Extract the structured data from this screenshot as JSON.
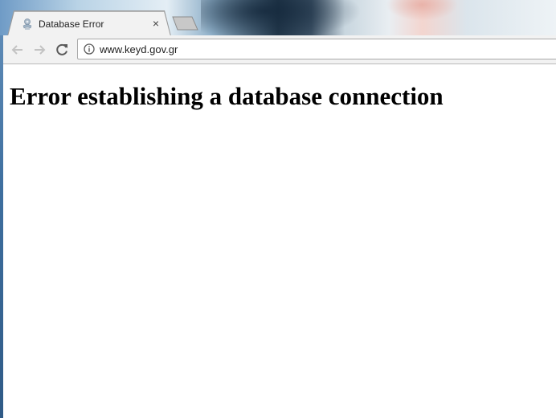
{
  "tab": {
    "title": "Database Error",
    "favicon": "wordpress-seal-icon",
    "close_label": "×"
  },
  "toolbar": {
    "back_icon": "back-arrow-icon",
    "forward_icon": "forward-arrow-icon",
    "reload_icon": "reload-icon",
    "info_icon": "info-icon",
    "url": "www.keyd.gov.gr"
  },
  "page": {
    "heading": "Error establishing a database connection"
  },
  "colors": {
    "chrome": "#f2f2f2",
    "page_background": "#ffffff",
    "text": "#000000"
  }
}
